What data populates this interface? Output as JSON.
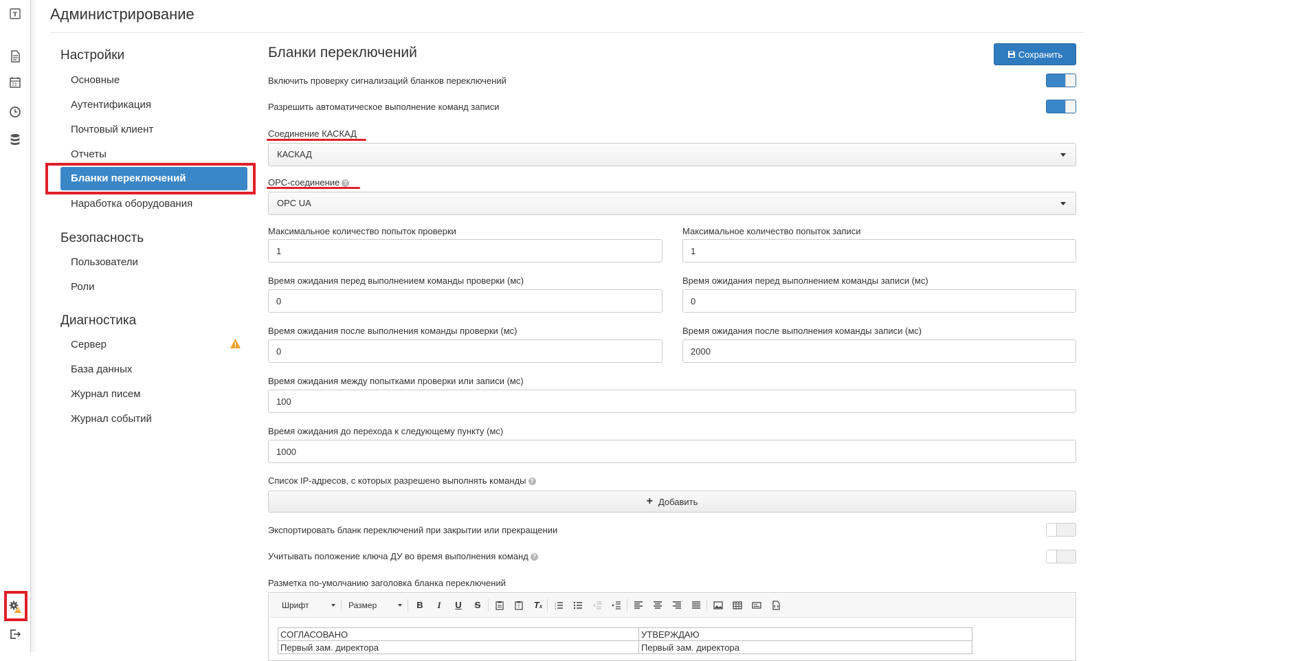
{
  "app": {
    "title": "Администрирование",
    "logo_letter": "T"
  },
  "rail": {
    "icons": [
      "document-icon",
      "calendar-icon",
      "clock-icon",
      "database-icon",
      "settings-warning-icon",
      "logout-icon"
    ]
  },
  "sidebar": {
    "sections": [
      {
        "title": "Настройки",
        "items": [
          "Основные",
          "Аутентификация",
          "Почтовый клиент",
          "Отчеты",
          "Бланки переключений",
          "Наработка оборудования"
        ]
      },
      {
        "title": "Безопасность",
        "items": [
          "Пользователи",
          "Роли"
        ]
      },
      {
        "title": "Диагностика",
        "items": [
          "Сервер",
          "База данных",
          "Журнал писем",
          "Журнал событий"
        ]
      }
    ],
    "active_item": "Бланки переключений"
  },
  "main": {
    "title": "Бланки переключений",
    "save_label": "Сохранить",
    "toggle1_label": "Включить проверку сигнализаций бланков переключений",
    "toggle1_on": true,
    "toggle2_label": "Разрешить автоматическое выполнение команд записи",
    "toggle2_on": true,
    "connection_label": "Соединение КАСКАД",
    "connection_value": "КАСКАД",
    "opc_label": "OPC-соединение",
    "opc_value": "OPC UA",
    "max_check_label": "Максимальное количество попыток проверки",
    "max_check_value": "1",
    "max_write_label": "Максимальное количество попыток записи",
    "max_write_value": "1",
    "wait_before_check_label": "Время ожидания перед выполнением команды проверки (мс)",
    "wait_before_check_value": "0",
    "wait_before_write_label": "Время ожидания перед выполнением команды записи (мс)",
    "wait_before_write_value": "0",
    "wait_after_check_label": "Время ожидания после выполнения команды проверки (мс)",
    "wait_after_check_value": "0",
    "wait_after_write_label": "Время ожидания после выполнения команды записи (мс)",
    "wait_after_write_value": "2000",
    "wait_between_label": "Время ожидания между попытками проверки или записи (мс)",
    "wait_between_value": "100",
    "wait_next_label": "Время ожидания до перехода к следующему пункту (мс)",
    "wait_next_value": "1000",
    "ip_list_label": "Список IP-адресов, с которых разрешено выполнять команды",
    "add_label": "Добавить",
    "export_label": "Экспортировать бланк переключений при закрытии или прекращении",
    "export_on": false,
    "key_label": "Учитывать положение ключа ДУ во время выполнения команд",
    "key_on": false,
    "markup_label": "Разметка по-умолчанию заголовка бланка переключений"
  },
  "editor": {
    "font_label": "Шрифт",
    "size_label": "Размер",
    "table": [
      [
        "СОГЛАСОВАНО",
        "УТВЕРЖДАЮ"
      ],
      [
        "Первый зам. директора",
        "Первый зам. директора"
      ]
    ]
  },
  "colors": {
    "accent": "#3a87c8",
    "highlight": "#e0202a",
    "warning": "#f0a030"
  }
}
